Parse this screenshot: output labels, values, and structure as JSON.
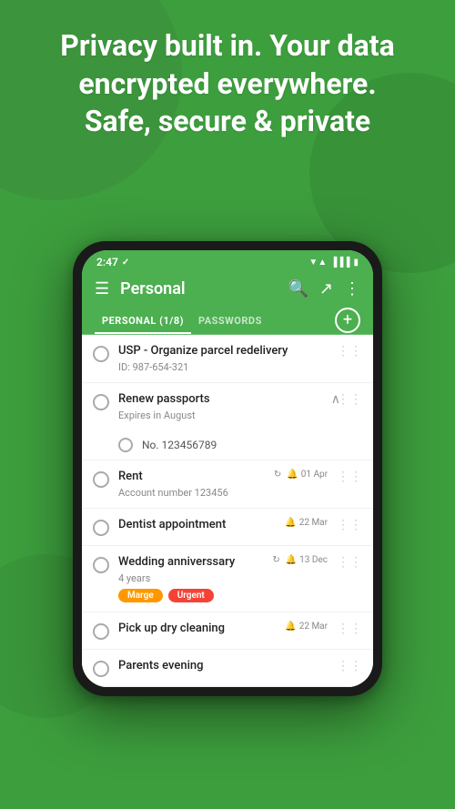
{
  "background": {
    "color": "#3d9e3d"
  },
  "hero": {
    "text": "Privacy built in. Your data encrypted everywhere.\nSafe, secure & private"
  },
  "status_bar": {
    "time": "2:47",
    "checkmark": "✓"
  },
  "app_bar": {
    "title": "Personal",
    "menu_icon": "☰",
    "search_icon": "🔍",
    "share_icon": "↗",
    "more_icon": "⋮"
  },
  "tabs": [
    {
      "label": "PERSONAL (1/8)",
      "active": true
    },
    {
      "label": "PASSWORDS",
      "active": false
    }
  ],
  "add_button_label": "+",
  "tasks": [
    {
      "id": "task-1",
      "title": "USP - Organize parcel redelivery",
      "subtitle": "ID: 987-654-321",
      "has_subtasks": false,
      "expanded": false,
      "date": "",
      "repeat": ""
    },
    {
      "id": "task-2",
      "title": "Renew passports",
      "subtitle": "Expires in August",
      "has_subtasks": true,
      "expanded": true,
      "subtasks": [
        {
          "id": "sub-1",
          "title": "No. 123456789"
        }
      ],
      "date": "",
      "repeat": ""
    },
    {
      "id": "task-3",
      "title": "Rent",
      "subtitle": "Account number 123456",
      "has_subtasks": false,
      "expanded": false,
      "date": "01 Apr",
      "repeat": "↻",
      "alarm": true
    },
    {
      "id": "task-4",
      "title": "Dentist appointment",
      "subtitle": "",
      "has_subtasks": false,
      "expanded": false,
      "date": "22 Mar",
      "repeat": "",
      "alarm": true
    },
    {
      "id": "task-5",
      "title": "Wedding anniverssary",
      "subtitle": "4 years",
      "has_subtasks": false,
      "expanded": false,
      "date": "13 Dec",
      "repeat": "↻",
      "alarm": true,
      "tags": [
        {
          "label": "Marge",
          "type": "marge"
        },
        {
          "label": "Urgent",
          "type": "urgent"
        }
      ]
    },
    {
      "id": "task-6",
      "title": "Pick up dry cleaning",
      "subtitle": "",
      "has_subtasks": false,
      "expanded": false,
      "date": "22 Mar",
      "repeat": "",
      "alarm": true
    },
    {
      "id": "task-7",
      "title": "Parents evening",
      "subtitle": "",
      "has_subtasks": false,
      "expanded": false,
      "date": "",
      "repeat": ""
    }
  ]
}
